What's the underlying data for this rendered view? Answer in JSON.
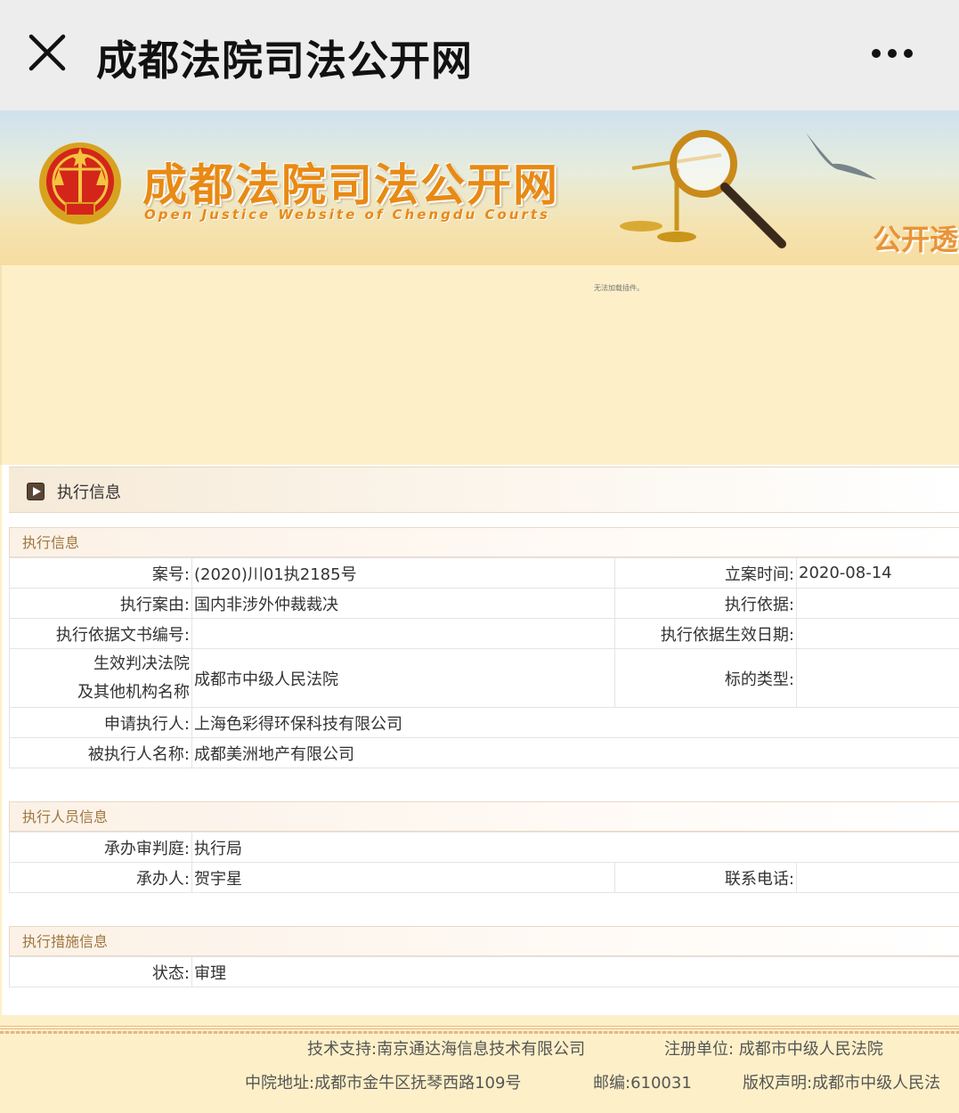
{
  "appbar": {
    "title": "成都法院司法公开网",
    "close_icon": "close-icon",
    "more_icon": "more-dots-icon"
  },
  "banner": {
    "cn_title": "成都法院司法公开网",
    "en_title": "Open Justice Website of Chengdu Courts",
    "slogan": "公开透",
    "colors": {
      "title": "#e88a14",
      "sky": "#cfe2ee",
      "sand": "#f6dca0"
    }
  },
  "plugin_message": "无法加载插件。",
  "panel": {
    "title": "执行信息",
    "sections": {
      "exec_info": {
        "title": "执行信息",
        "case_no_label": "案号:",
        "case_no": "(2020)川01执2185号",
        "filing_date_label": "立案时间:",
        "filing_date": "2020-08-14",
        "cause_label": "执行案由:",
        "cause": "国内非涉外仲裁裁决",
        "basis_label": "执行依据:",
        "basis": "",
        "doc_no_label": "执行依据文书编号:",
        "doc_no": "",
        "effective_date_label": "执行依据生效日期:",
        "effective_date": "",
        "court_label_line1": "生效判决法院",
        "court_label_line2": "及其他机构名称",
        "court": "成都市中级人民法院",
        "subject_type_label": "标的类型:",
        "subject_type": "",
        "applicant_label": "申请执行人:",
        "applicant": "上海色彩得环保科技有限公司",
        "respondent_label": "被执行人名称:",
        "respondent": "成都美洲地产有限公司"
      },
      "personnel": {
        "title": "执行人员信息",
        "tribunal_label": "承办审判庭:",
        "tribunal": "执行局",
        "handler_label": "承办人:",
        "handler": "贺宇星",
        "phone_label": "联系电话:",
        "phone": ""
      },
      "measures": {
        "title": "执行措施信息",
        "status_label": "状态:",
        "status": "审理"
      }
    }
  },
  "footer": {
    "tech_support": "技术支持:南京通达海信息技术有限公司",
    "registrant": "注册单位: 成都市中级人民法院",
    "address": "中院地址:成都市金牛区抚琴西路109号",
    "postcode": "邮编:610031",
    "copyright": "版权声明:成都市中级人民法"
  }
}
